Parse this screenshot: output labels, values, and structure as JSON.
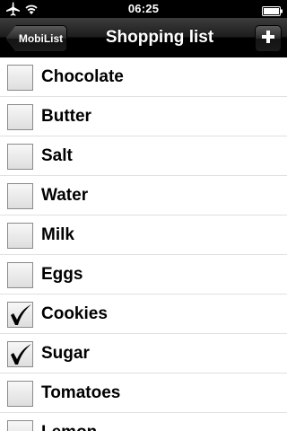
{
  "status_bar": {
    "time": "06:25",
    "icons": [
      "airplane-icon",
      "wifi-icon",
      "battery-icon"
    ]
  },
  "nav_bar": {
    "back_label": "MobiList",
    "title": "Shopping list",
    "add_label": "+"
  },
  "items": [
    {
      "label": "Chocolate",
      "checked": false
    },
    {
      "label": "Butter",
      "checked": false
    },
    {
      "label": "Salt",
      "checked": false
    },
    {
      "label": "Water",
      "checked": false
    },
    {
      "label": "Milk",
      "checked": false
    },
    {
      "label": "Eggs",
      "checked": false
    },
    {
      "label": "Cookies",
      "checked": true
    },
    {
      "label": "Sugar",
      "checked": true
    },
    {
      "label": "Tomatoes",
      "checked": false
    },
    {
      "label": "Lemon",
      "checked": false
    }
  ],
  "colors": {
    "nav_bg": "#000000",
    "text": "#000000",
    "separator": "#e0e0e0"
  }
}
